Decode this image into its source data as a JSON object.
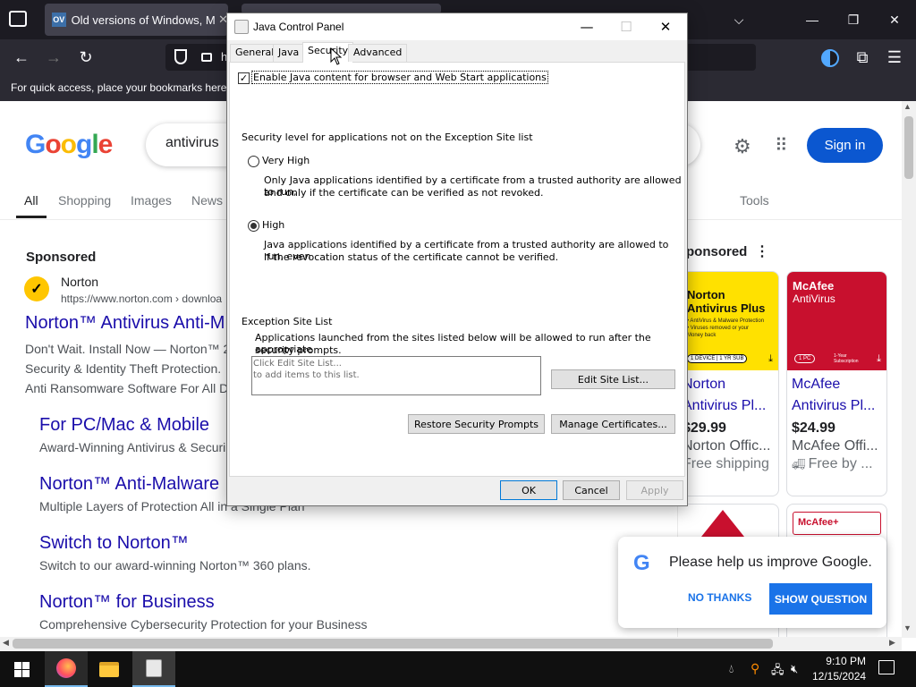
{
  "browser": {
    "tab_title": "Old versions of Windows, Mac ...",
    "tab_favicon": "OV",
    "tab_close": "✕",
    "back_icon": "←",
    "forward_icon": "→",
    "reload_icon": "↻",
    "url_text": "h",
    "bookmarks_hint": "For quick access, place your bookmarks here o",
    "min": "—",
    "max": "❐",
    "close": "✕",
    "list_tabs": "⌵",
    "star_icon": "☆",
    "ext_icon": "⧉",
    "menu_icon": "☰"
  },
  "google": {
    "logo": "Google",
    "search_value": "antivirus",
    "sign_in": "Sign in",
    "settings_icon": "⚙",
    "apps_icon": "⠿",
    "filters": [
      "All",
      "Shopping",
      "Images",
      "News"
    ],
    "tools": "Tools",
    "sponsored": "Sponsored",
    "ad": {
      "advertiser": "Norton",
      "url": "https://www.norton.com › downloa",
      "title": "Norton™ Antivirus Anti-M",
      "desc_lines": [
        "Don't Wait. Install Now — Norton™ 2",
        "Security & Identity Theft Protection.",
        "Anti Ransomware Software For All D"
      ],
      "sitelinks": [
        {
          "title": "For PC/Mac & Mobile",
          "desc": "Award-Winning Antivirus & Securi"
        },
        {
          "title": "Norton™ Anti-Malware",
          "desc": "Multiple Layers of Protection All in a Single Plan"
        },
        {
          "title": "Switch to Norton™",
          "desc": "Switch to our award-winning Norton™ 360 plans."
        },
        {
          "title": "Norton™ for Business",
          "desc": "Comprehensive Cybersecurity Protection for your Business"
        }
      ]
    },
    "right_sponsored": "ponsored",
    "products": [
      {
        "img_title": "Norton Antivirus Plus",
        "img_lines": [
          "• AntiVirus & Malware Protection",
          "• Viruses removed or your",
          "  Money back"
        ],
        "img_badge": "1 DEVICE | 1 YR SUB",
        "name": "Norton Antivirus Pl...",
        "price": "$29.99",
        "store": "Norton Offic...",
        "shipping": "Free shipping"
      },
      {
        "img_title": "McAfee",
        "img_subtitle": "AntiVirus",
        "img_badge": "1 PC",
        "img_badge2": "1-Year Subscription",
        "name": "McAfee Antivirus Pl...",
        "price": "$24.99",
        "store": "McAfee Offi...",
        "shipping": "Free by ..."
      }
    ],
    "mcafee_plus": "McAfee+",
    "help_text": "Please help us improve Google.",
    "no_thanks": "NO THANKS",
    "show_question": "SHOW QUESTION"
  },
  "java_panel": {
    "title": "Java Control Panel",
    "tabs": [
      "General",
      "Java",
      "Security",
      "Advanced"
    ],
    "enable_label": "Enable Java content for browser and Web Start applications",
    "security_level_label": "Security level for applications not on the Exception Site list",
    "very_high": "Very High",
    "very_high_desc_1": "Only Java applications identified by a certificate from a trusted authority are allowed to run,",
    "very_high_desc_2": "and only if the certificate can be verified as not revoked.",
    "high": "High",
    "high_desc_1": "Java applications identified by a certificate from a trusted authority are allowed to run, even",
    "high_desc_2": "if the revocation status of the certificate cannot be verified.",
    "exception_header": "Exception Site List",
    "exception_desc_1": "Applications launched from the sites listed below will be allowed to run after the appropriate",
    "exception_desc_2": "security prompts.",
    "site_list_hint_1": "Click Edit Site List...",
    "site_list_hint_2": "to add items to this list.",
    "edit_site_list": "Edit Site List...",
    "restore_prompts": "Restore Security Prompts",
    "manage_certs": "Manage Certificates...",
    "ok": "OK",
    "cancel": "Cancel",
    "apply": "Apply",
    "enabled_checked": true,
    "selected_level": "High"
  },
  "taskbar": {
    "time": "9:10 PM",
    "date": "12/15/2024"
  }
}
